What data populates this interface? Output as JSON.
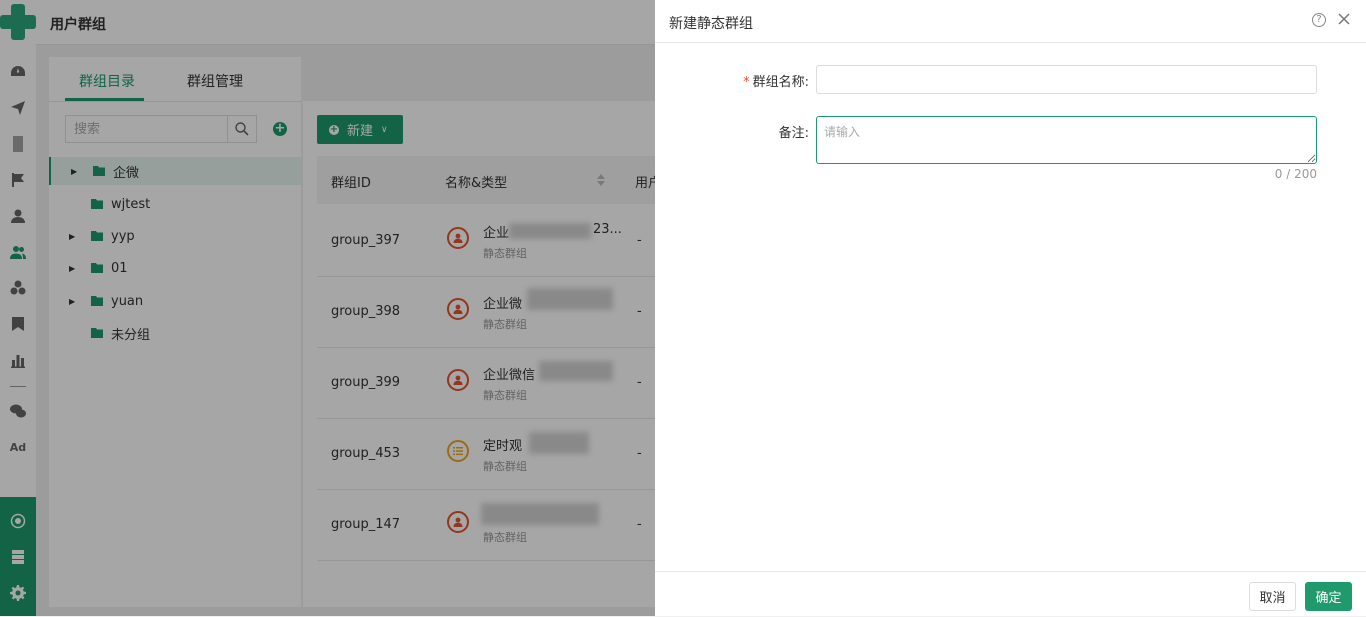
{
  "header": {
    "title": "用户群组"
  },
  "left_panel": {
    "tabs": [
      {
        "label": "群组目录",
        "active": true
      },
      {
        "label": "群组管理",
        "active": false
      }
    ],
    "search": {
      "placeholder": "搜索",
      "value": ""
    },
    "tree": [
      {
        "label": "企微",
        "expandable": true,
        "selected": true
      },
      {
        "label": "wjtest",
        "expandable": false,
        "selected": false
      },
      {
        "label": "yyp",
        "expandable": true,
        "selected": false
      },
      {
        "label": "01",
        "expandable": true,
        "selected": false
      },
      {
        "label": "yuan",
        "expandable": true,
        "selected": false
      },
      {
        "label": "未分组",
        "expandable": false,
        "selected": false
      }
    ]
  },
  "toolbar": {
    "new_label": "新建"
  },
  "table": {
    "columns": [
      "群组ID",
      "名称&类型",
      "用户"
    ],
    "rows": [
      {
        "id": "group_397",
        "name": "企业",
        "name_suffix": "23...",
        "type": "静态群组",
        "icon": "person-icon",
        "value": "-"
      },
      {
        "id": "group_398",
        "name": "企业微",
        "name_suffix": "",
        "type": "静态群组",
        "icon": "person-icon",
        "value": "-"
      },
      {
        "id": "group_399",
        "name": "企业微信",
        "name_suffix": "",
        "type": "静态群组",
        "icon": "person-icon",
        "value": "-"
      },
      {
        "id": "group_453",
        "name": "定时观",
        "name_suffix": "",
        "type": "静态群组",
        "icon": "list-icon",
        "value": "-"
      },
      {
        "id": "group_147",
        "name": "",
        "name_suffix": "",
        "type": "静态群组",
        "icon": "person-icon",
        "value": "-"
      }
    ]
  },
  "drawer": {
    "title": "新建静态群组",
    "fields": {
      "name_label": "群组名称:",
      "name_value": "",
      "remark_label": "备注:",
      "remark_placeholder": "请输入",
      "remark_counter": "0 / 200"
    },
    "cancel_label": "取消",
    "ok_label": "确定"
  },
  "nav": {
    "ad_label": "Ad",
    "icons": [
      "dashboard-icon",
      "send-icon",
      "document-icon",
      "flag-icon",
      "user-icon",
      "users-icon",
      "segments-icon",
      "bookmark-icon",
      "bar-chart-icon",
      "wechat-icon",
      "ad-icon",
      "hub-icon",
      "server-icon",
      "settings-icon"
    ]
  },
  "colors": {
    "accent": "#1e9a6c",
    "danger": "#e2532f",
    "warning": "#f0a524"
  }
}
